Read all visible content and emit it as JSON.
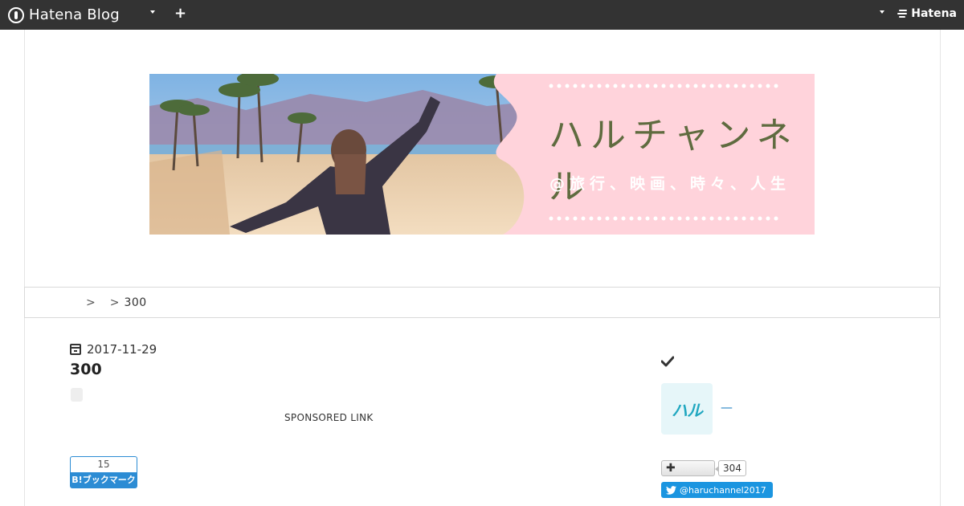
{
  "globalbar": {
    "logo_text": "Hatena Blog",
    "hatena_text": "Hatena"
  },
  "header": {
    "banner_title": "ハルチャンネル",
    "banner_subtitle": "@旅行、映画、時々、人生"
  },
  "breadcrumb": {
    "items": [
      {
        "label": ""
      },
      {
        "label": ""
      }
    ],
    "separator": ">",
    "current": "300"
  },
  "entry": {
    "date": "2017-11-29",
    "title": "300",
    "sponsored_label": "SPONSORED LINK",
    "bookmark": {
      "count": "15",
      "label": "B!ブックマーク"
    }
  },
  "sidebar": {
    "avatar_text": "ハル",
    "profile_name": "—",
    "reader_count": "304",
    "twitter_handle": "@haruchannel2017"
  },
  "colors": {
    "globalbar_bg": "#333333",
    "banner_pink": "#ffd3db",
    "banner_title": "#5f6b3f",
    "hatena_blue": "#2c8cd4",
    "twitter_blue": "#1b95e0",
    "link_blue": "#1f7fc1"
  },
  "icons": {
    "logo": "hatena-blog-logo-icon",
    "calendar": "calendar-icon",
    "check": "check-icon",
    "plus": "plus-icon",
    "twitter": "twitter-bird-icon"
  }
}
